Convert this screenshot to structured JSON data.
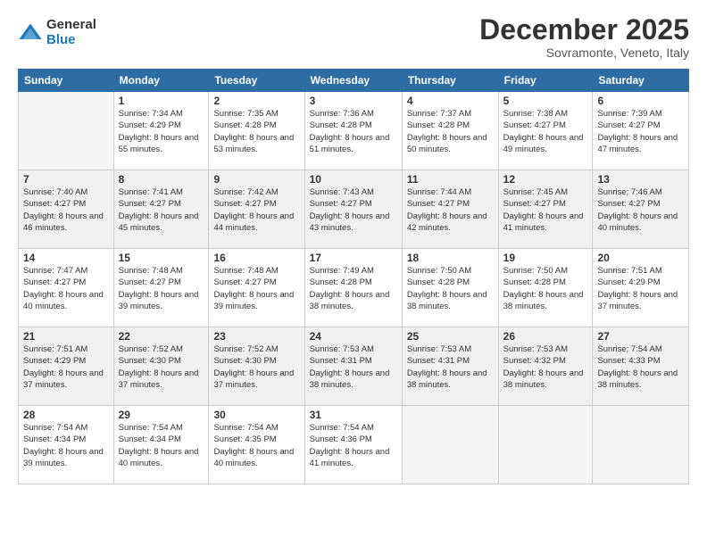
{
  "logo": {
    "general": "General",
    "blue": "Blue"
  },
  "title": "December 2025",
  "location": "Sovramonte, Veneto, Italy",
  "days_header": [
    "Sunday",
    "Monday",
    "Tuesday",
    "Wednesday",
    "Thursday",
    "Friday",
    "Saturday"
  ],
  "weeks": [
    [
      {
        "day": "",
        "sunrise": "",
        "sunset": "",
        "daylight": "",
        "empty": true
      },
      {
        "day": "1",
        "sunrise": "Sunrise: 7:34 AM",
        "sunset": "Sunset: 4:29 PM",
        "daylight": "Daylight: 8 hours and 55 minutes."
      },
      {
        "day": "2",
        "sunrise": "Sunrise: 7:35 AM",
        "sunset": "Sunset: 4:28 PM",
        "daylight": "Daylight: 8 hours and 53 minutes."
      },
      {
        "day": "3",
        "sunrise": "Sunrise: 7:36 AM",
        "sunset": "Sunset: 4:28 PM",
        "daylight": "Daylight: 8 hours and 51 minutes."
      },
      {
        "day": "4",
        "sunrise": "Sunrise: 7:37 AM",
        "sunset": "Sunset: 4:28 PM",
        "daylight": "Daylight: 8 hours and 50 minutes."
      },
      {
        "day": "5",
        "sunrise": "Sunrise: 7:38 AM",
        "sunset": "Sunset: 4:27 PM",
        "daylight": "Daylight: 8 hours and 49 minutes."
      },
      {
        "day": "6",
        "sunrise": "Sunrise: 7:39 AM",
        "sunset": "Sunset: 4:27 PM",
        "daylight": "Daylight: 8 hours and 47 minutes."
      }
    ],
    [
      {
        "day": "7",
        "sunrise": "Sunrise: 7:40 AM",
        "sunset": "Sunset: 4:27 PM",
        "daylight": "Daylight: 8 hours and 46 minutes."
      },
      {
        "day": "8",
        "sunrise": "Sunrise: 7:41 AM",
        "sunset": "Sunset: 4:27 PM",
        "daylight": "Daylight: 8 hours and 45 minutes."
      },
      {
        "day": "9",
        "sunrise": "Sunrise: 7:42 AM",
        "sunset": "Sunset: 4:27 PM",
        "daylight": "Daylight: 8 hours and 44 minutes."
      },
      {
        "day": "10",
        "sunrise": "Sunrise: 7:43 AM",
        "sunset": "Sunset: 4:27 PM",
        "daylight": "Daylight: 8 hours and 43 minutes."
      },
      {
        "day": "11",
        "sunrise": "Sunrise: 7:44 AM",
        "sunset": "Sunset: 4:27 PM",
        "daylight": "Daylight: 8 hours and 42 minutes."
      },
      {
        "day": "12",
        "sunrise": "Sunrise: 7:45 AM",
        "sunset": "Sunset: 4:27 PM",
        "daylight": "Daylight: 8 hours and 41 minutes."
      },
      {
        "day": "13",
        "sunrise": "Sunrise: 7:46 AM",
        "sunset": "Sunset: 4:27 PM",
        "daylight": "Daylight: 8 hours and 40 minutes."
      }
    ],
    [
      {
        "day": "14",
        "sunrise": "Sunrise: 7:47 AM",
        "sunset": "Sunset: 4:27 PM",
        "daylight": "Daylight: 8 hours and 40 minutes."
      },
      {
        "day": "15",
        "sunrise": "Sunrise: 7:48 AM",
        "sunset": "Sunset: 4:27 PM",
        "daylight": "Daylight: 8 hours and 39 minutes."
      },
      {
        "day": "16",
        "sunrise": "Sunrise: 7:48 AM",
        "sunset": "Sunset: 4:27 PM",
        "daylight": "Daylight: 8 hours and 39 minutes."
      },
      {
        "day": "17",
        "sunrise": "Sunrise: 7:49 AM",
        "sunset": "Sunset: 4:28 PM",
        "daylight": "Daylight: 8 hours and 38 minutes."
      },
      {
        "day": "18",
        "sunrise": "Sunrise: 7:50 AM",
        "sunset": "Sunset: 4:28 PM",
        "daylight": "Daylight: 8 hours and 38 minutes."
      },
      {
        "day": "19",
        "sunrise": "Sunrise: 7:50 AM",
        "sunset": "Sunset: 4:28 PM",
        "daylight": "Daylight: 8 hours and 38 minutes."
      },
      {
        "day": "20",
        "sunrise": "Sunrise: 7:51 AM",
        "sunset": "Sunset: 4:29 PM",
        "daylight": "Daylight: 8 hours and 37 minutes."
      }
    ],
    [
      {
        "day": "21",
        "sunrise": "Sunrise: 7:51 AM",
        "sunset": "Sunset: 4:29 PM",
        "daylight": "Daylight: 8 hours and 37 minutes."
      },
      {
        "day": "22",
        "sunrise": "Sunrise: 7:52 AM",
        "sunset": "Sunset: 4:30 PM",
        "daylight": "Daylight: 8 hours and 37 minutes."
      },
      {
        "day": "23",
        "sunrise": "Sunrise: 7:52 AM",
        "sunset": "Sunset: 4:30 PM",
        "daylight": "Daylight: 8 hours and 37 minutes."
      },
      {
        "day": "24",
        "sunrise": "Sunrise: 7:53 AM",
        "sunset": "Sunset: 4:31 PM",
        "daylight": "Daylight: 8 hours and 38 minutes."
      },
      {
        "day": "25",
        "sunrise": "Sunrise: 7:53 AM",
        "sunset": "Sunset: 4:31 PM",
        "daylight": "Daylight: 8 hours and 38 minutes."
      },
      {
        "day": "26",
        "sunrise": "Sunrise: 7:53 AM",
        "sunset": "Sunset: 4:32 PM",
        "daylight": "Daylight: 8 hours and 38 minutes."
      },
      {
        "day": "27",
        "sunrise": "Sunrise: 7:54 AM",
        "sunset": "Sunset: 4:33 PM",
        "daylight": "Daylight: 8 hours and 38 minutes."
      }
    ],
    [
      {
        "day": "28",
        "sunrise": "Sunrise: 7:54 AM",
        "sunset": "Sunset: 4:34 PM",
        "daylight": "Daylight: 8 hours and 39 minutes."
      },
      {
        "day": "29",
        "sunrise": "Sunrise: 7:54 AM",
        "sunset": "Sunset: 4:34 PM",
        "daylight": "Daylight: 8 hours and 40 minutes."
      },
      {
        "day": "30",
        "sunrise": "Sunrise: 7:54 AM",
        "sunset": "Sunset: 4:35 PM",
        "daylight": "Daylight: 8 hours and 40 minutes."
      },
      {
        "day": "31",
        "sunrise": "Sunrise: 7:54 AM",
        "sunset": "Sunset: 4:36 PM",
        "daylight": "Daylight: 8 hours and 41 minutes."
      },
      {
        "day": "",
        "sunrise": "",
        "sunset": "",
        "daylight": "",
        "empty": true
      },
      {
        "day": "",
        "sunrise": "",
        "sunset": "",
        "daylight": "",
        "empty": true
      },
      {
        "day": "",
        "sunrise": "",
        "sunset": "",
        "daylight": "",
        "empty": true
      }
    ]
  ]
}
